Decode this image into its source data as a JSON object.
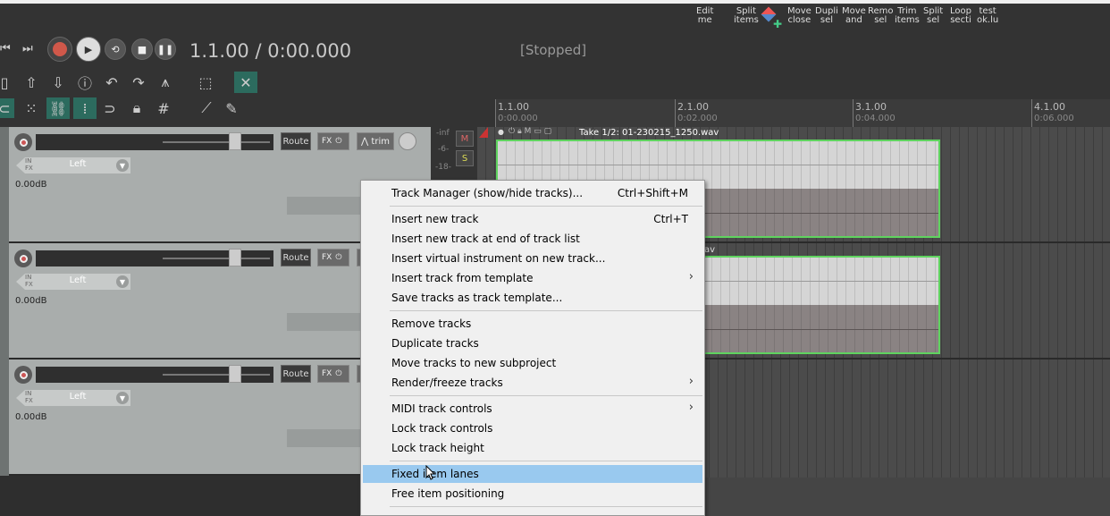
{
  "toolbar": {
    "custom_buttons": [
      {
        "line1": "Edit",
        "line2": "me"
      },
      {
        "line1": "Split",
        "line2": "items"
      },
      {
        "line1": "Move",
        "line2": "close"
      },
      {
        "line1": "Dupli",
        "line2": "sel"
      },
      {
        "line1": "Move",
        "line2": "and"
      },
      {
        "line1": "Remo",
        "line2": "sel"
      },
      {
        "line1": "Trim",
        "line2": "items"
      },
      {
        "line1": "Split",
        "line2": "sel"
      },
      {
        "line1": "Loop",
        "line2": "secti"
      },
      {
        "line1": "test",
        "line2": "ok.lu"
      }
    ]
  },
  "transport": {
    "timecode": "1.1.00 / 0:00.000",
    "status": "[Stopped]"
  },
  "ruler": {
    "marks": [
      {
        "bar": "1.1.00",
        "time": "0:00.000"
      },
      {
        "bar": "2.1.00",
        "time": "0:02.000"
      },
      {
        "bar": "3.1.00",
        "time": "0:04.000"
      },
      {
        "bar": "4.1.00",
        "time": "0:06.000"
      }
    ]
  },
  "tracks": [
    {
      "route": "Route",
      "fx": "FX",
      "trim": "trim",
      "pan_io": "IN\nFX",
      "pan": "Left",
      "volume": "0.00dB"
    },
    {
      "route": "Route",
      "fx": "FX",
      "trim": "",
      "pan_io": "IN\nFX",
      "pan": "Left",
      "volume": "0.00dB"
    },
    {
      "route": "Route",
      "fx": "FX",
      "trim": "",
      "pan_io": "IN\nFX",
      "pan": "Left",
      "volume": "0.00dB"
    }
  ],
  "meter": {
    "labels": [
      "-inf",
      "-6-",
      "-18-"
    ],
    "mute": "M",
    "solo": "S"
  },
  "item": {
    "take_label": "Take 1/2: 01-230215_1250.wav",
    "second_fragment": "av"
  },
  "context_menu": {
    "items": [
      {
        "label": "Track Manager (show/hide tracks)...",
        "shortcut": "Ctrl+Shift+M",
        "submenu": false
      },
      {
        "label": "Insert new track",
        "shortcut": "Ctrl+T",
        "submenu": false
      },
      {
        "label": "Insert new track at end of track list",
        "shortcut": "",
        "submenu": false
      },
      {
        "label": "Insert virtual instrument on new track...",
        "shortcut": "",
        "submenu": false
      },
      {
        "label": "Insert track from template",
        "shortcut": "",
        "submenu": true
      },
      {
        "label": "Save tracks as track template...",
        "shortcut": "",
        "submenu": false
      },
      {
        "label": "Remove tracks",
        "shortcut": "",
        "submenu": false
      },
      {
        "label": "Duplicate tracks",
        "shortcut": "",
        "submenu": false
      },
      {
        "label": "Move tracks to new subproject",
        "shortcut": "",
        "submenu": false
      },
      {
        "label": "Render/freeze tracks",
        "shortcut": "",
        "submenu": true
      },
      {
        "label": "MIDI track controls",
        "shortcut": "",
        "submenu": true
      },
      {
        "label": "Lock track controls",
        "shortcut": "",
        "submenu": false
      },
      {
        "label": "Lock track height",
        "shortcut": "",
        "submenu": false
      },
      {
        "label": "Fixed item lanes",
        "shortcut": "",
        "submenu": false,
        "highlighted": true
      },
      {
        "label": "Free item positioning",
        "shortcut": "",
        "submenu": false
      }
    ],
    "submenu_arrow": "›"
  }
}
